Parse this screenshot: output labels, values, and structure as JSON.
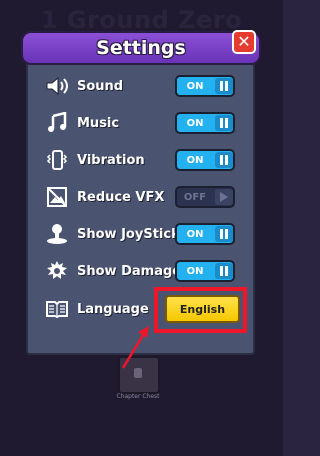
{
  "background": {
    "title": "1 Ground Zero",
    "chest_label": "Chapter Chest"
  },
  "dialog": {
    "title": "Settings",
    "close_label": "✕",
    "rows": [
      {
        "label": "Sound",
        "icon": "speaker-icon",
        "state": "ON"
      },
      {
        "label": "Music",
        "icon": "music-note-icon",
        "state": "ON"
      },
      {
        "label": "Vibration",
        "icon": "vibration-icon",
        "state": "ON"
      },
      {
        "label": "Reduce VFX",
        "icon": "reduce-vfx-icon",
        "state": "OFF"
      },
      {
        "label": "Show JoyStick",
        "icon": "joystick-icon",
        "state": "ON"
      },
      {
        "label": "Show Damage",
        "icon": "damage-icon",
        "state": "ON"
      }
    ],
    "language": {
      "label": "Language",
      "icon": "book-icon",
      "value": "English"
    }
  },
  "colors": {
    "toggle_on": "#23b2ef",
    "toggle_off": "#2c3350",
    "header": "#7a42c8",
    "highlight": "#f0162a",
    "language_button": "#f6c700"
  }
}
